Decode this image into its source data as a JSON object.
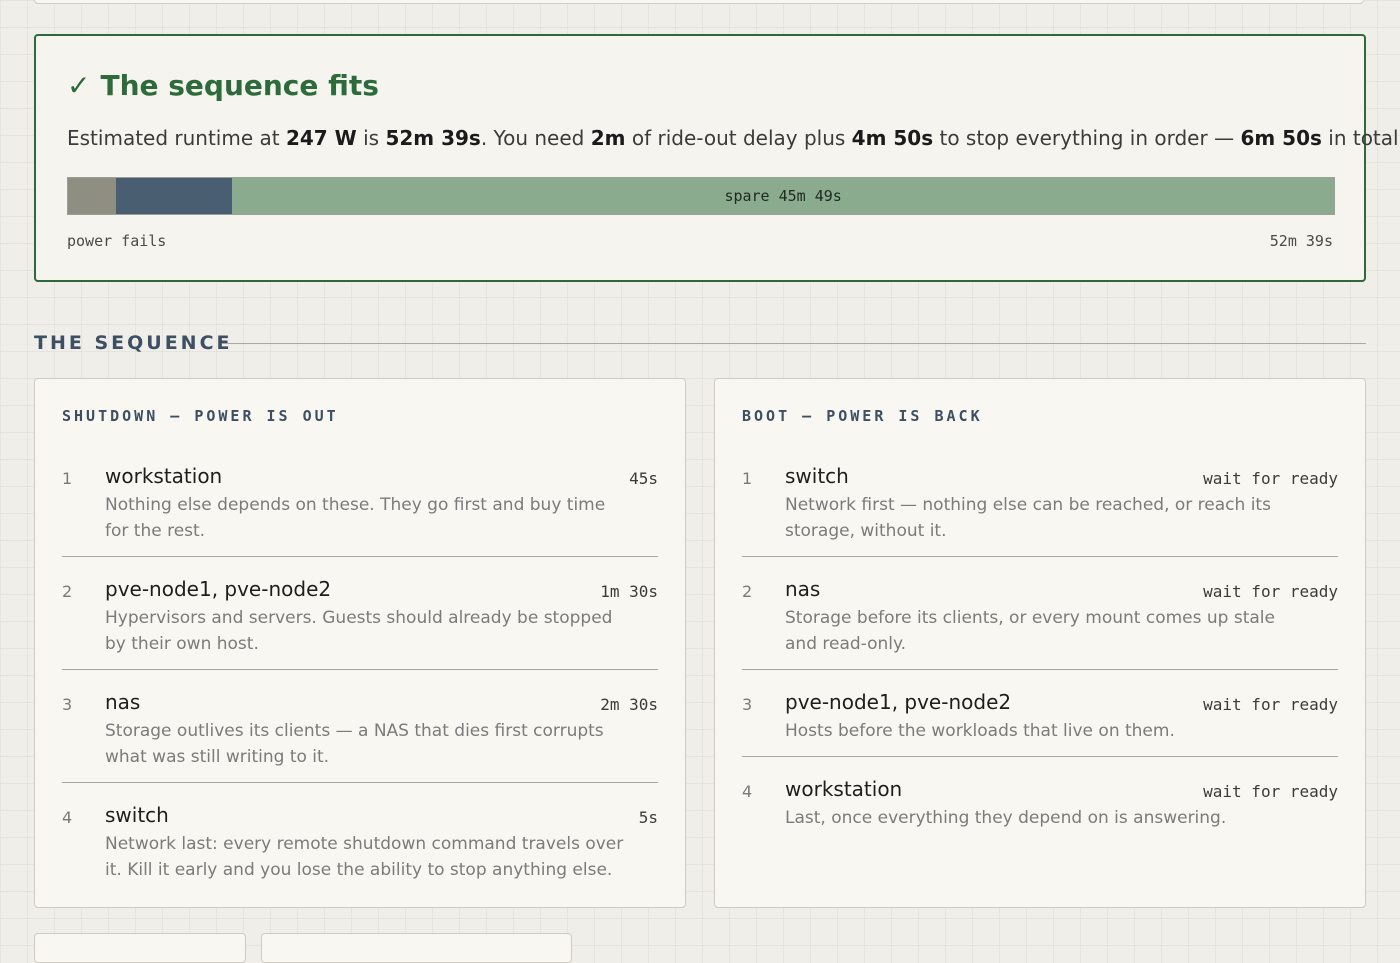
{
  "result": {
    "check_icon": "✓",
    "title": "The sequence fits",
    "summary": {
      "t1": "Estimated runtime at ",
      "watts": "247 W",
      "t2": " is ",
      "runtime": "52m 39s",
      "t3": ". You need ",
      "delay": "2m",
      "t4": " of ride-out delay plus ",
      "stop": "4m 50s",
      "t5": " to stop everything in order — ",
      "total": "6m 50s",
      "t6": " in total."
    },
    "timeline": {
      "runtime_seconds": 3159,
      "delay_seconds": 120,
      "stop_seconds": 290,
      "spare_label": "spare 45m 49s",
      "start_label": "power fails",
      "end_label": "52m 39s",
      "colors": {
        "delay": "#8e8e82",
        "stop": "#4a5e72",
        "spare": "#8aab8e"
      }
    }
  },
  "sequence": {
    "heading": "THE SEQUENCE",
    "shutdown": {
      "title": "SHUTDOWN — POWER IS OUT",
      "steps": [
        {
          "num": "1",
          "name": "workstation",
          "desc": "Nothing else depends on these. They go first and buy time for the rest.",
          "time": "45s"
        },
        {
          "num": "2",
          "name": "pve-node1, pve-node2",
          "desc": "Hypervisors and servers. Guests should already be stopped by their own host.",
          "time": "1m 30s"
        },
        {
          "num": "3",
          "name": "nas",
          "desc": "Storage outlives its clients — a NAS that dies first corrupts what was still writing to it.",
          "time": "2m 30s"
        },
        {
          "num": "4",
          "name": "switch",
          "desc": "Network last: every remote shutdown command travels over it. Kill it early and you lose the ability to stop anything else.",
          "time": "5s"
        }
      ]
    },
    "boot": {
      "title": "BOOT — POWER IS BACK",
      "steps": [
        {
          "num": "1",
          "name": "switch",
          "desc": "Network first — nothing else can be reached, or reach its storage, without it.",
          "time": "wait for ready"
        },
        {
          "num": "2",
          "name": "nas",
          "desc": "Storage before its clients, or every mount comes up stale and read-only.",
          "time": "wait for ready"
        },
        {
          "num": "3",
          "name": "pve-node1, pve-node2",
          "desc": "Hosts before the workloads that live on them.",
          "time": "wait for ready"
        },
        {
          "num": "4",
          "name": "workstation",
          "desc": "Last, once everything they depend on is answering.",
          "time": "wait for ready"
        }
      ]
    }
  },
  "colors": {
    "accent_green": "#2e6b3a",
    "heading_blue": "#3d4f62"
  }
}
